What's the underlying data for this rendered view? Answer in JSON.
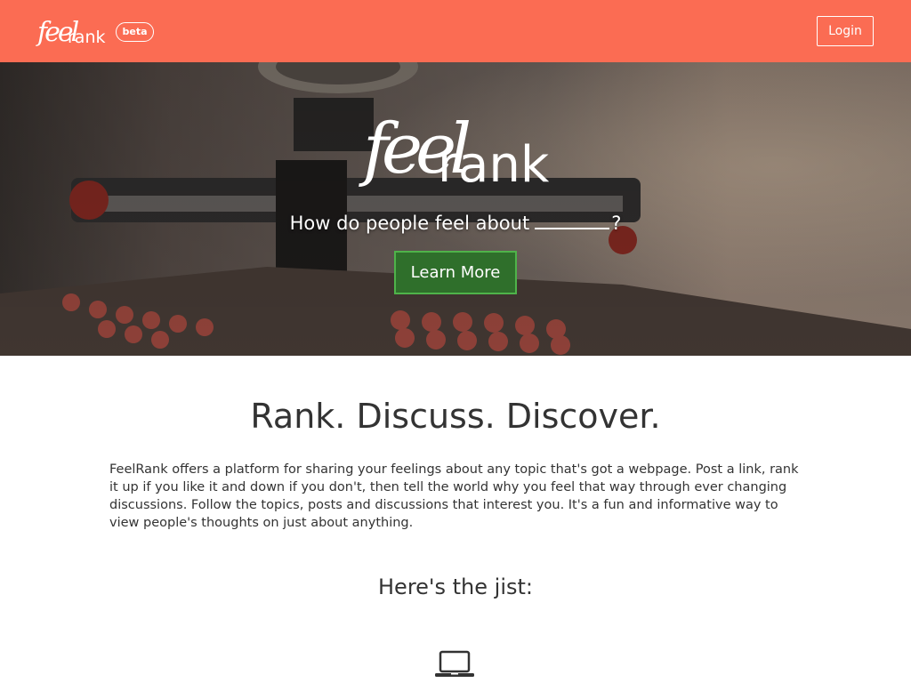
{
  "navbar": {
    "logo_alt": "feel rank",
    "beta_label": "beta",
    "login_label": "Login",
    "bg_color": "#fb6c53"
  },
  "hero": {
    "logo_alt": "feel rank",
    "tagline": "How do people feel about",
    "tagline_end": "?",
    "learn_more_label": "Learn More",
    "button_color": "#2f6f2b"
  },
  "main": {
    "headline": "Rank. Discuss. Discover.",
    "intro": "FeelRank offers a platform for sharing your feelings about any topic that's got a webpage. Post a link, rank it up if you like it and down if you don't, then tell the world why you feel that way through ever changing discussions. Follow the topics, posts and discussions that interest you. It's a fun and informative way to view people's thoughts on just about anything.",
    "subhead": "Here's the jist:",
    "feature_icon": "laptop-icon"
  }
}
